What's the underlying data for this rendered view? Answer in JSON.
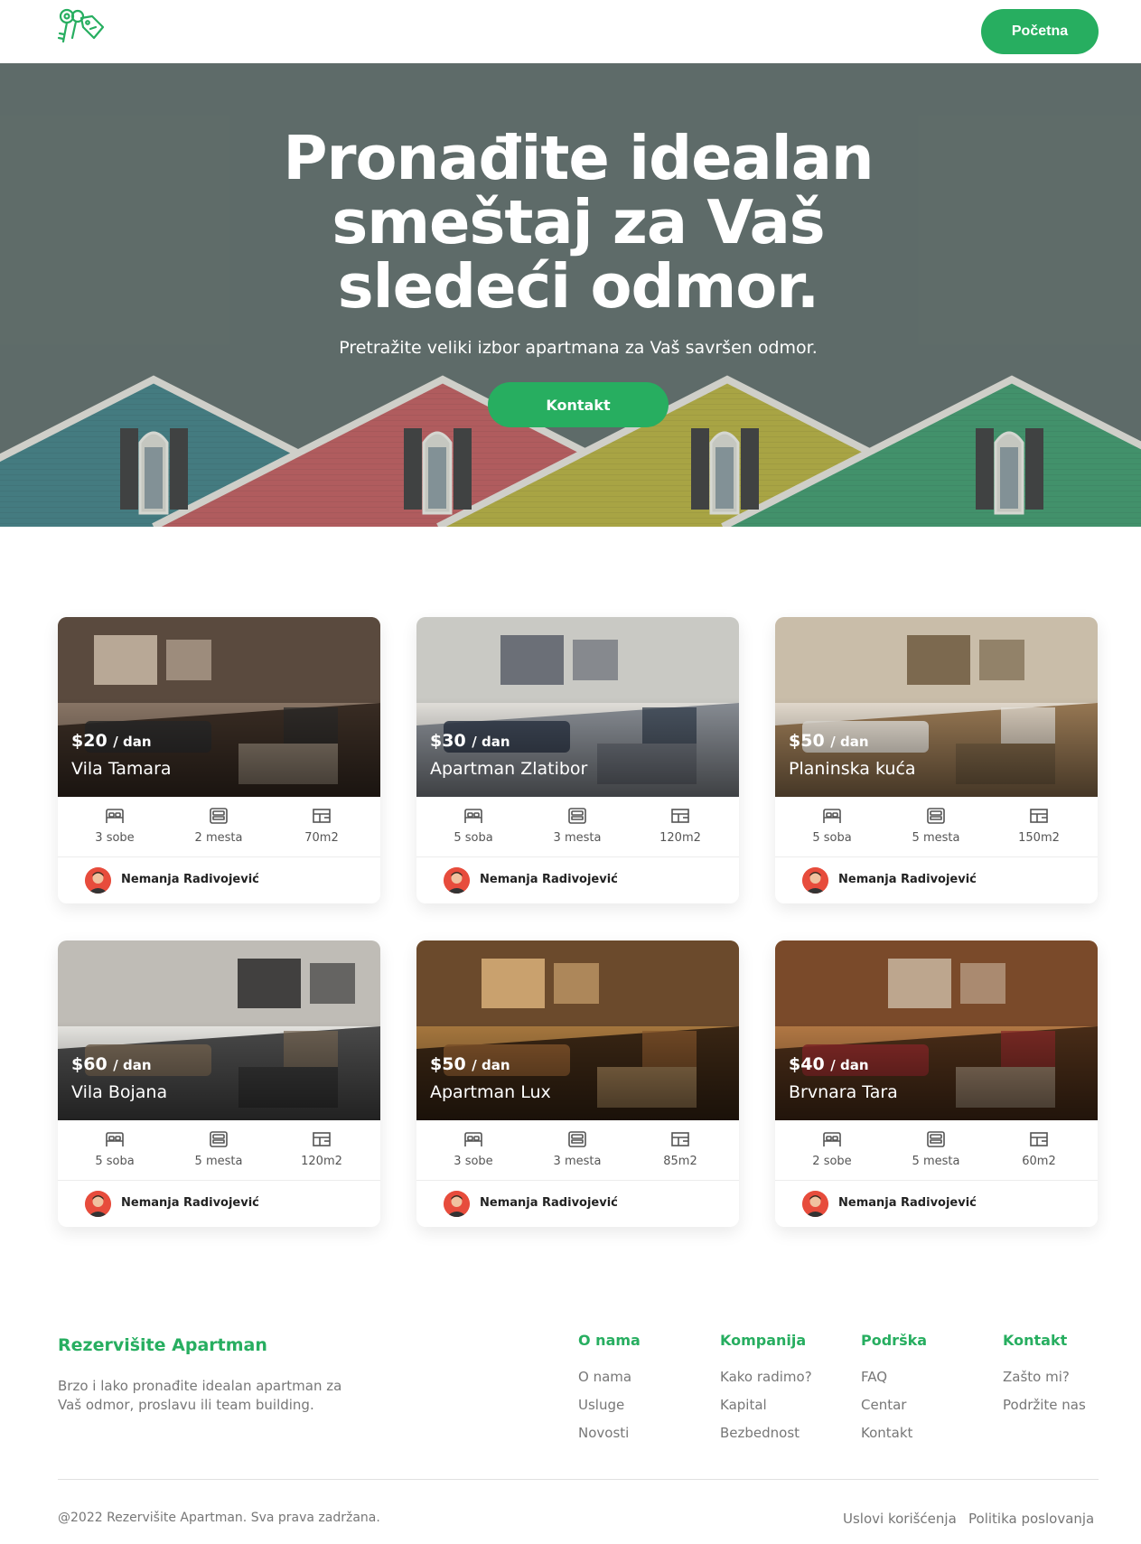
{
  "header": {
    "logo_icon": "keys-icon",
    "nav_button": "Početna"
  },
  "hero": {
    "title_line1": "Pronađite idealan",
    "title_line2": "smeštaj za Vaš",
    "title_line3": "sledeći odmor.",
    "subtitle": "Pretražite veliki izbor apartmana za Vaš savršen odmor.",
    "cta": "Kontakt"
  },
  "listings": [
    {
      "price": "$20",
      "per": "/ dan",
      "name": "Vila Tamara",
      "rooms": "3 sobe",
      "beds": "2 mesta",
      "area": "70m2",
      "owner": "Nemanja Radivojević"
    },
    {
      "price": "$30",
      "per": "/ dan",
      "name": "Apartman Zlatibor",
      "rooms": "5 soba",
      "beds": "3 mesta",
      "area": "120m2",
      "owner": "Nemanja Radivojević"
    },
    {
      "price": "$50",
      "per": "/ dan",
      "name": "Planinska kuća",
      "rooms": "5 soba",
      "beds": "5 mesta",
      "area": "150m2",
      "owner": "Nemanja Radivojević"
    },
    {
      "price": "$60",
      "per": "/ dan",
      "name": "Vila Bojana",
      "rooms": "5 soba",
      "beds": "5 mesta",
      "area": "120m2",
      "owner": "Nemanja Radivojević"
    },
    {
      "price": "$50",
      "per": "/ dan",
      "name": "Apartman Lux",
      "rooms": "3 sobe",
      "beds": "3 mesta",
      "area": "85m2",
      "owner": "Nemanja Radivojević"
    },
    {
      "price": "$40",
      "per": "/ dan",
      "name": "Brvnara Tara",
      "rooms": "2 sobe",
      "beds": "5 mesta",
      "area": "60m2",
      "owner": "Nemanja Radivojević"
    }
  ],
  "footer": {
    "brand": "Rezervišite Apartman",
    "description": "Brzo i lako pronađite idealan apartman za Vaš odmor, proslavu ili team building.",
    "columns": [
      {
        "title": "O nama",
        "links": [
          "O nama",
          "Usluge",
          "Novosti"
        ]
      },
      {
        "title": "Kompanija",
        "links": [
          "Kako radimo?",
          "Kapital",
          "Bezbednost"
        ]
      },
      {
        "title": "Podrška",
        "links": [
          "FAQ",
          "Centar",
          "Kontakt"
        ]
      },
      {
        "title": "Kontakt",
        "links": [
          "Zašto mi?",
          "Podržite nas"
        ]
      }
    ],
    "copyright": "@2022 Rezervišite Apartman. Sva prava zadržana.",
    "terms": "Uslovi korišćenja",
    "policy": "Politika poslovanja"
  },
  "colors": {
    "accent": "#27ae60",
    "hero_overlay": "#5f6c69",
    "text_muted": "#777777"
  }
}
